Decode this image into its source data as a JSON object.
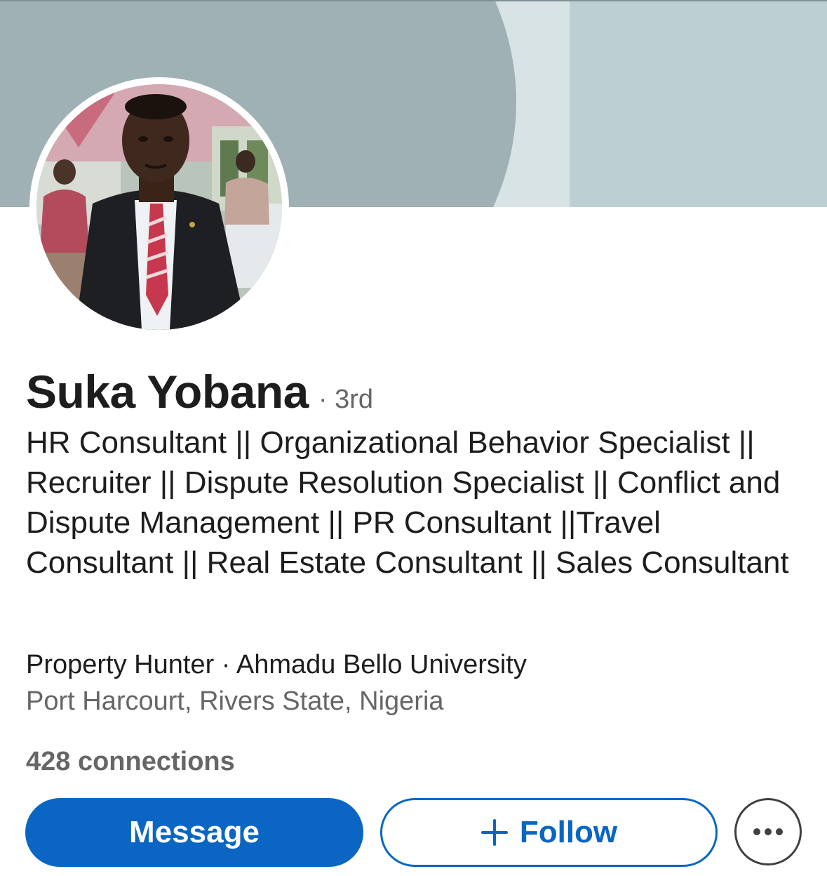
{
  "profile": {
    "name": "Suka Yobana",
    "degree": "· 3rd",
    "headline": "HR Consultant || Organizational Behavior Specialist || Recruiter || Dispute Resolution Specialist || Conflict and Dispute Management || PR Consultant ||Travel Consultant || Real Estate Consultant || Sales Consultant",
    "company_line": "Property Hunter · Ahmadu Bello University",
    "location": "Port Harcourt, Rivers State, Nigeria",
    "connections": "428 connections"
  },
  "actions": {
    "message_label": "Message",
    "follow_label": "Follow",
    "more_icon": "ellipsis-icon",
    "follow_icon": "plus-icon"
  },
  "colors": {
    "primary": "#0a66c2",
    "banner": "#9fb1b5",
    "secondary_text": "#666666"
  }
}
